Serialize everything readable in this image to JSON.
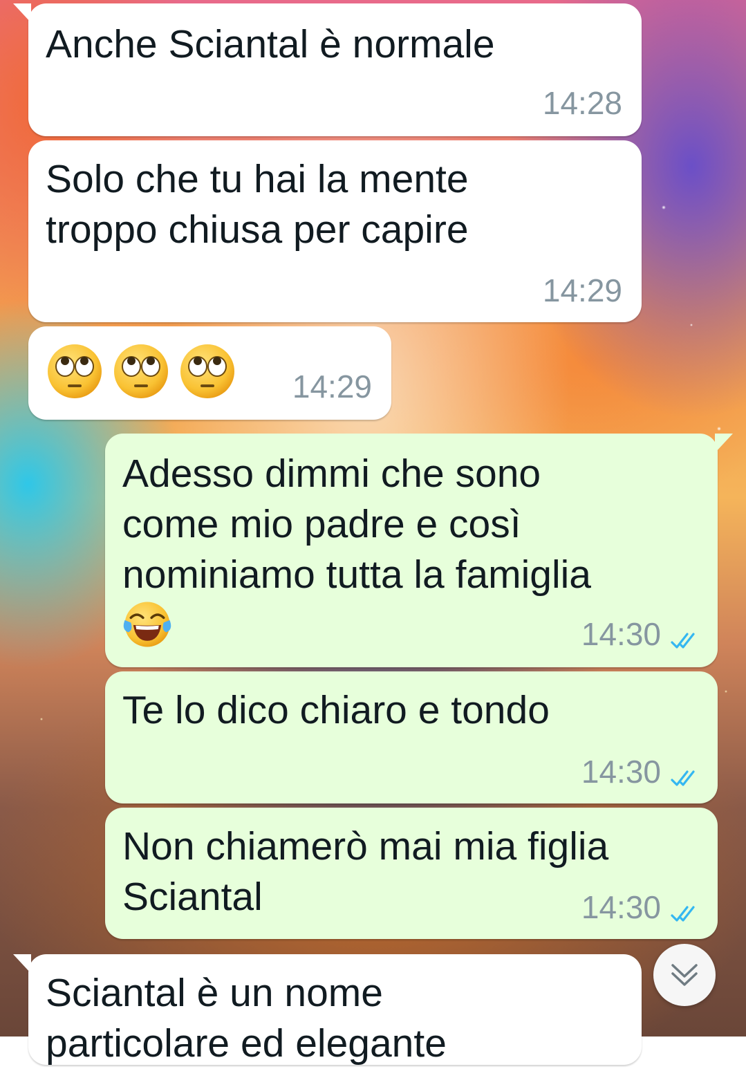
{
  "chat": {
    "messages": [
      {
        "direction": "incoming",
        "text": "Anche Sciantal è normale",
        "time": "14:28"
      },
      {
        "direction": "incoming",
        "text": "Solo che tu hai la mente\ntroppo chiusa per capire",
        "time": "14:29"
      },
      {
        "direction": "incoming",
        "emojis": [
          "face-with-rolling-eyes",
          "face-with-rolling-eyes",
          "face-with-rolling-eyes"
        ],
        "time": "14:29"
      },
      {
        "direction": "outgoing",
        "text": "Adesso dimmi che sono\ncome mio padre e così\nnominiamo tutta la famiglia",
        "emojis": [
          "face-with-tears-of-joy"
        ],
        "time": "14:30",
        "status": "read"
      },
      {
        "direction": "outgoing",
        "text": "Te lo dico chiaro e tondo",
        "time": "14:30",
        "status": "read"
      },
      {
        "direction": "outgoing",
        "text": "Non chiamerò mai mia figlia\nSciantal",
        "time": "14:30",
        "status": "read"
      },
      {
        "direction": "incoming",
        "text": "Sciantal è un nome\nparticolare ed elegante"
      }
    ]
  },
  "scroll_button": {
    "icon": "double-chevron-down-icon"
  },
  "colors": {
    "incoming_bubble": "#ffffff",
    "outgoing_bubble": "#e7ffdb",
    "timestamp": "#8696a0",
    "read_ticks": "#34b7f1",
    "message_text": "#111b21"
  }
}
